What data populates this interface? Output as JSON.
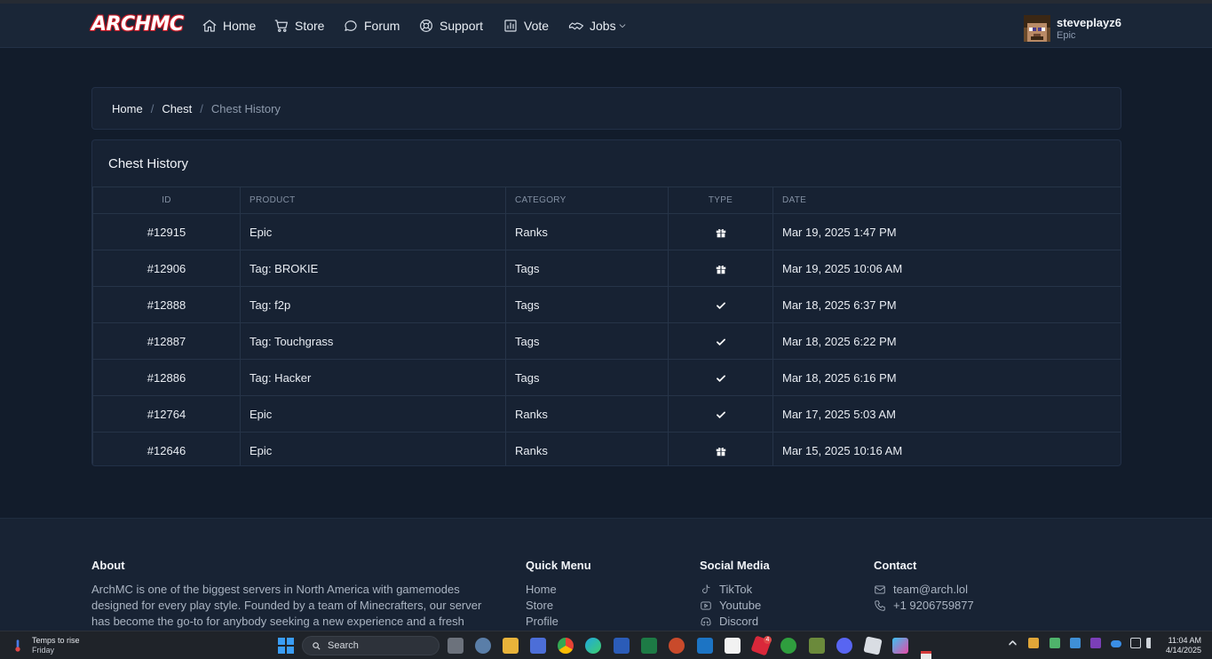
{
  "navbar": {
    "logo": "ARCHMC",
    "items": [
      {
        "label": "Home",
        "icon": "home-icon"
      },
      {
        "label": "Store",
        "icon": "cart-icon"
      },
      {
        "label": "Forum",
        "icon": "chat-icon"
      },
      {
        "label": "Support",
        "icon": "lifebuoy-icon"
      },
      {
        "label": "Vote",
        "icon": "chart-icon"
      },
      {
        "label": "Jobs",
        "icon": "handshake-icon"
      }
    ],
    "user": {
      "name": "steveplayz6",
      "rank": "Epic"
    }
  },
  "breadcrumb": {
    "items": [
      "Home",
      "Chest"
    ],
    "current": "Chest History",
    "separator": "/"
  },
  "chest_history": {
    "title": "Chest History",
    "columns": [
      "ID",
      "PRODUCT",
      "CATEGORY",
      "TYPE",
      "DATE"
    ],
    "rows": [
      {
        "id": "#12915",
        "product": "Epic",
        "category": "Ranks",
        "type": "gift-icon",
        "date": "Mar 19, 2025 1:47 PM"
      },
      {
        "id": "#12906",
        "product": "Tag: BROKIE",
        "category": "Tags",
        "type": "gift-icon",
        "date": "Mar 19, 2025 10:06 AM"
      },
      {
        "id": "#12888",
        "product": "Tag: f2p",
        "category": "Tags",
        "type": "check-icon",
        "date": "Mar 18, 2025 6:37 PM"
      },
      {
        "id": "#12887",
        "product": "Tag: Touchgrass",
        "category": "Tags",
        "type": "check-icon",
        "date": "Mar 18, 2025 6:22 PM"
      },
      {
        "id": "#12886",
        "product": "Tag: Hacker",
        "category": "Tags",
        "type": "check-icon",
        "date": "Mar 18, 2025 6:16 PM"
      },
      {
        "id": "#12764",
        "product": "Epic",
        "category": "Ranks",
        "type": "check-icon",
        "date": "Mar 17, 2025 5:03 AM"
      },
      {
        "id": "#12646",
        "product": "Epic",
        "category": "Ranks",
        "type": "gift-icon",
        "date": "Mar 15, 2025 10:16 AM"
      }
    ]
  },
  "footer": {
    "about": {
      "title": "About",
      "lines": [
        "ArchMC is one of the biggest servers in North America with gamemodes",
        "designed for every play style. Founded by a team of Minecrafters, our server",
        "has become the go-to for anybody seeking a new experience and a fresh"
      ]
    },
    "quick_menu": {
      "title": "Quick Menu",
      "items": [
        "Home",
        "Store",
        "Profile"
      ]
    },
    "social": {
      "title": "Social Media",
      "items": [
        {
          "label": "TikTok",
          "icon": "tiktok-icon"
        },
        {
          "label": "Youtube",
          "icon": "youtube-icon"
        },
        {
          "label": "Discord",
          "icon": "discord-icon"
        }
      ]
    },
    "contact": {
      "title": "Contact",
      "items": [
        {
          "label": "team@arch.lol",
          "icon": "mail-icon"
        },
        {
          "label": "+1 9206759877",
          "icon": "phone-icon"
        }
      ]
    }
  },
  "taskbar": {
    "weather_line1": "Temps to rise",
    "weather_line2": "Friday",
    "search_placeholder": "Search",
    "time": "11:04 AM",
    "date": "4/14/2025",
    "notification_badge": "4"
  },
  "colors": {
    "background": "#121c2b",
    "navbar": "#1a2637",
    "card": "#172233",
    "border": "#223047",
    "logo_red": "#c1121f"
  }
}
